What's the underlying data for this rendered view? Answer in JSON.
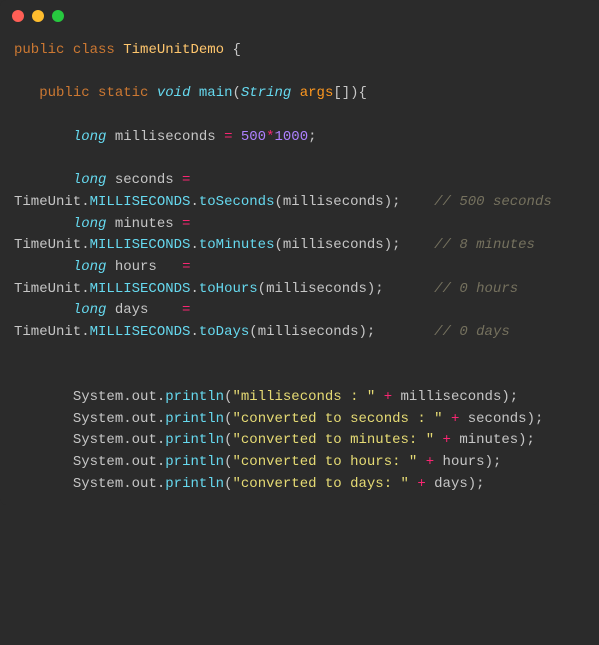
{
  "code": {
    "tokens": [
      {
        "cls": "kw",
        "t": "public"
      },
      {
        "cls": "punct",
        "t": " "
      },
      {
        "cls": "kw",
        "t": "class"
      },
      {
        "cls": "punct",
        "t": " "
      },
      {
        "cls": "cls",
        "t": "TimeUnitDemo"
      },
      {
        "cls": "punct",
        "t": " {"
      },
      {
        "cls": "punct",
        "t": "\n\n"
      },
      {
        "cls": "punct",
        "t": "   "
      },
      {
        "cls": "kw",
        "t": "public"
      },
      {
        "cls": "punct",
        "t": " "
      },
      {
        "cls": "kw",
        "t": "static"
      },
      {
        "cls": "punct",
        "t": " "
      },
      {
        "cls": "type",
        "t": "void"
      },
      {
        "cls": "punct",
        "t": " "
      },
      {
        "cls": "call",
        "t": "main"
      },
      {
        "cls": "punct",
        "t": "("
      },
      {
        "cls": "type",
        "t": "String"
      },
      {
        "cls": "punct",
        "t": " "
      },
      {
        "cls": "var",
        "t": "args"
      },
      {
        "cls": "punct",
        "t": "[]){"
      },
      {
        "cls": "punct",
        "t": "\n\n"
      },
      {
        "cls": "punct",
        "t": "       "
      },
      {
        "cls": "type",
        "t": "long"
      },
      {
        "cls": "punct",
        "t": " "
      },
      {
        "cls": "obj",
        "t": "milliseconds"
      },
      {
        "cls": "punct",
        "t": " "
      },
      {
        "cls": "op",
        "t": "="
      },
      {
        "cls": "punct",
        "t": " "
      },
      {
        "cls": "num",
        "t": "500"
      },
      {
        "cls": "op",
        "t": "*"
      },
      {
        "cls": "num",
        "t": "1000"
      },
      {
        "cls": "punct",
        "t": ";"
      },
      {
        "cls": "punct",
        "t": "\n\n"
      },
      {
        "cls": "punct",
        "t": "       "
      },
      {
        "cls": "type",
        "t": "long"
      },
      {
        "cls": "punct",
        "t": " "
      },
      {
        "cls": "obj",
        "t": "seconds"
      },
      {
        "cls": "punct",
        "t": " "
      },
      {
        "cls": "op",
        "t": "="
      },
      {
        "cls": "punct",
        "t": " \n"
      },
      {
        "cls": "obj",
        "t": "TimeUnit"
      },
      {
        "cls": "punct",
        "t": "."
      },
      {
        "cls": "field",
        "t": "MILLISECONDS"
      },
      {
        "cls": "punct",
        "t": "."
      },
      {
        "cls": "call",
        "t": "toSeconds"
      },
      {
        "cls": "punct",
        "t": "("
      },
      {
        "cls": "obj",
        "t": "milliseconds"
      },
      {
        "cls": "punct",
        "t": ");    "
      },
      {
        "cls": "comment",
        "t": "// 500 seconds"
      },
      {
        "cls": "punct",
        "t": "\n"
      },
      {
        "cls": "punct",
        "t": "       "
      },
      {
        "cls": "type",
        "t": "long"
      },
      {
        "cls": "punct",
        "t": " "
      },
      {
        "cls": "obj",
        "t": "minutes"
      },
      {
        "cls": "punct",
        "t": " "
      },
      {
        "cls": "op",
        "t": "="
      },
      {
        "cls": "punct",
        "t": " \n"
      },
      {
        "cls": "obj",
        "t": "TimeUnit"
      },
      {
        "cls": "punct",
        "t": "."
      },
      {
        "cls": "field",
        "t": "MILLISECONDS"
      },
      {
        "cls": "punct",
        "t": "."
      },
      {
        "cls": "call",
        "t": "toMinutes"
      },
      {
        "cls": "punct",
        "t": "("
      },
      {
        "cls": "obj",
        "t": "milliseconds"
      },
      {
        "cls": "punct",
        "t": ");    "
      },
      {
        "cls": "comment",
        "t": "// 8 minutes"
      },
      {
        "cls": "punct",
        "t": "\n"
      },
      {
        "cls": "punct",
        "t": "       "
      },
      {
        "cls": "type",
        "t": "long"
      },
      {
        "cls": "punct",
        "t": " "
      },
      {
        "cls": "obj",
        "t": "hours"
      },
      {
        "cls": "punct",
        "t": "   "
      },
      {
        "cls": "op",
        "t": "="
      },
      {
        "cls": "punct",
        "t": " \n"
      },
      {
        "cls": "obj",
        "t": "TimeUnit"
      },
      {
        "cls": "punct",
        "t": "."
      },
      {
        "cls": "field",
        "t": "MILLISECONDS"
      },
      {
        "cls": "punct",
        "t": "."
      },
      {
        "cls": "call",
        "t": "toHours"
      },
      {
        "cls": "punct",
        "t": "("
      },
      {
        "cls": "obj",
        "t": "milliseconds"
      },
      {
        "cls": "punct",
        "t": ");      "
      },
      {
        "cls": "comment",
        "t": "// 0 hours"
      },
      {
        "cls": "punct",
        "t": "\n"
      },
      {
        "cls": "punct",
        "t": "       "
      },
      {
        "cls": "type",
        "t": "long"
      },
      {
        "cls": "punct",
        "t": " "
      },
      {
        "cls": "obj",
        "t": "days"
      },
      {
        "cls": "punct",
        "t": "    "
      },
      {
        "cls": "op",
        "t": "="
      },
      {
        "cls": "punct",
        "t": " \n"
      },
      {
        "cls": "obj",
        "t": "TimeUnit"
      },
      {
        "cls": "punct",
        "t": "."
      },
      {
        "cls": "field",
        "t": "MILLISECONDS"
      },
      {
        "cls": "punct",
        "t": "."
      },
      {
        "cls": "call",
        "t": "toDays"
      },
      {
        "cls": "punct",
        "t": "("
      },
      {
        "cls": "obj",
        "t": "milliseconds"
      },
      {
        "cls": "punct",
        "t": ");       "
      },
      {
        "cls": "comment",
        "t": "// 0 days"
      },
      {
        "cls": "punct",
        "t": "\n\n\n"
      },
      {
        "cls": "punct",
        "t": "       "
      },
      {
        "cls": "obj",
        "t": "System"
      },
      {
        "cls": "punct",
        "t": "."
      },
      {
        "cls": "obj",
        "t": "out"
      },
      {
        "cls": "punct",
        "t": "."
      },
      {
        "cls": "call",
        "t": "println"
      },
      {
        "cls": "punct",
        "t": "("
      },
      {
        "cls": "str",
        "t": "\"milliseconds : \""
      },
      {
        "cls": "punct",
        "t": " "
      },
      {
        "cls": "op",
        "t": "+"
      },
      {
        "cls": "punct",
        "t": " "
      },
      {
        "cls": "obj",
        "t": "milliseconds"
      },
      {
        "cls": "punct",
        "t": ");"
      },
      {
        "cls": "punct",
        "t": "\n"
      },
      {
        "cls": "punct",
        "t": "       "
      },
      {
        "cls": "obj",
        "t": "System"
      },
      {
        "cls": "punct",
        "t": "."
      },
      {
        "cls": "obj",
        "t": "out"
      },
      {
        "cls": "punct",
        "t": "."
      },
      {
        "cls": "call",
        "t": "println"
      },
      {
        "cls": "punct",
        "t": "("
      },
      {
        "cls": "str",
        "t": "\"converted to seconds : \""
      },
      {
        "cls": "punct",
        "t": " "
      },
      {
        "cls": "op",
        "t": "+"
      },
      {
        "cls": "punct",
        "t": " "
      },
      {
        "cls": "obj",
        "t": "seconds"
      },
      {
        "cls": "punct",
        "t": ");"
      },
      {
        "cls": "punct",
        "t": "\n"
      },
      {
        "cls": "punct",
        "t": "       "
      },
      {
        "cls": "obj",
        "t": "System"
      },
      {
        "cls": "punct",
        "t": "."
      },
      {
        "cls": "obj",
        "t": "out"
      },
      {
        "cls": "punct",
        "t": "."
      },
      {
        "cls": "call",
        "t": "println"
      },
      {
        "cls": "punct",
        "t": "("
      },
      {
        "cls": "str",
        "t": "\"converted to minutes: \""
      },
      {
        "cls": "punct",
        "t": " "
      },
      {
        "cls": "op",
        "t": "+"
      },
      {
        "cls": "punct",
        "t": " "
      },
      {
        "cls": "obj",
        "t": "minutes"
      },
      {
        "cls": "punct",
        "t": ");"
      },
      {
        "cls": "punct",
        "t": "\n"
      },
      {
        "cls": "punct",
        "t": "       "
      },
      {
        "cls": "obj",
        "t": "System"
      },
      {
        "cls": "punct",
        "t": "."
      },
      {
        "cls": "obj",
        "t": "out"
      },
      {
        "cls": "punct",
        "t": "."
      },
      {
        "cls": "call",
        "t": "println"
      },
      {
        "cls": "punct",
        "t": "("
      },
      {
        "cls": "str",
        "t": "\"converted to hours: \""
      },
      {
        "cls": "punct",
        "t": " "
      },
      {
        "cls": "op",
        "t": "+"
      },
      {
        "cls": "punct",
        "t": " "
      },
      {
        "cls": "obj",
        "t": "hours"
      },
      {
        "cls": "punct",
        "t": ");"
      },
      {
        "cls": "punct",
        "t": "\n"
      },
      {
        "cls": "punct",
        "t": "       "
      },
      {
        "cls": "obj",
        "t": "System"
      },
      {
        "cls": "punct",
        "t": "."
      },
      {
        "cls": "obj",
        "t": "out"
      },
      {
        "cls": "punct",
        "t": "."
      },
      {
        "cls": "call",
        "t": "println"
      },
      {
        "cls": "punct",
        "t": "("
      },
      {
        "cls": "str",
        "t": "\"converted to days: \""
      },
      {
        "cls": "punct",
        "t": " "
      },
      {
        "cls": "op",
        "t": "+"
      },
      {
        "cls": "punct",
        "t": " "
      },
      {
        "cls": "obj",
        "t": "days"
      },
      {
        "cls": "punct",
        "t": ");"
      }
    ]
  }
}
